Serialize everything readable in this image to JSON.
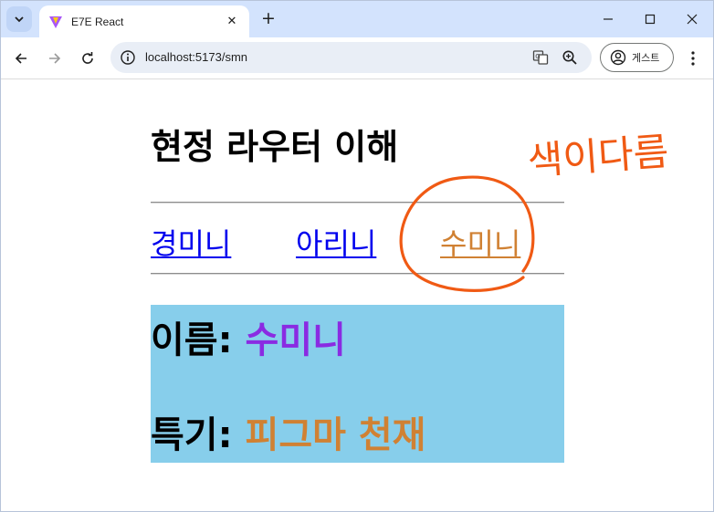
{
  "browser": {
    "tab_title": "E7E React",
    "url": "localhost:5173/smn",
    "profile_label": "게스트"
  },
  "page": {
    "title": "현정 라우터 이해",
    "nav_links": [
      {
        "label": "경미니",
        "active": false
      },
      {
        "label": "아리니",
        "active": false
      },
      {
        "label": "수미니",
        "active": true
      }
    ],
    "info": {
      "name_label": "이름:",
      "name_value": "수미니",
      "talent_label": "특기:",
      "talent_value": "피그마 천재"
    }
  },
  "annotation": {
    "text": "색이다름",
    "color": "#f05a14"
  },
  "colors": {
    "tabstrip": "#d3e3fd",
    "link": "#0000ee",
    "active_link": "#d08133",
    "info_bg": "#87ceeb",
    "name_value": "#8a2be2",
    "talent_value": "#d08133"
  }
}
